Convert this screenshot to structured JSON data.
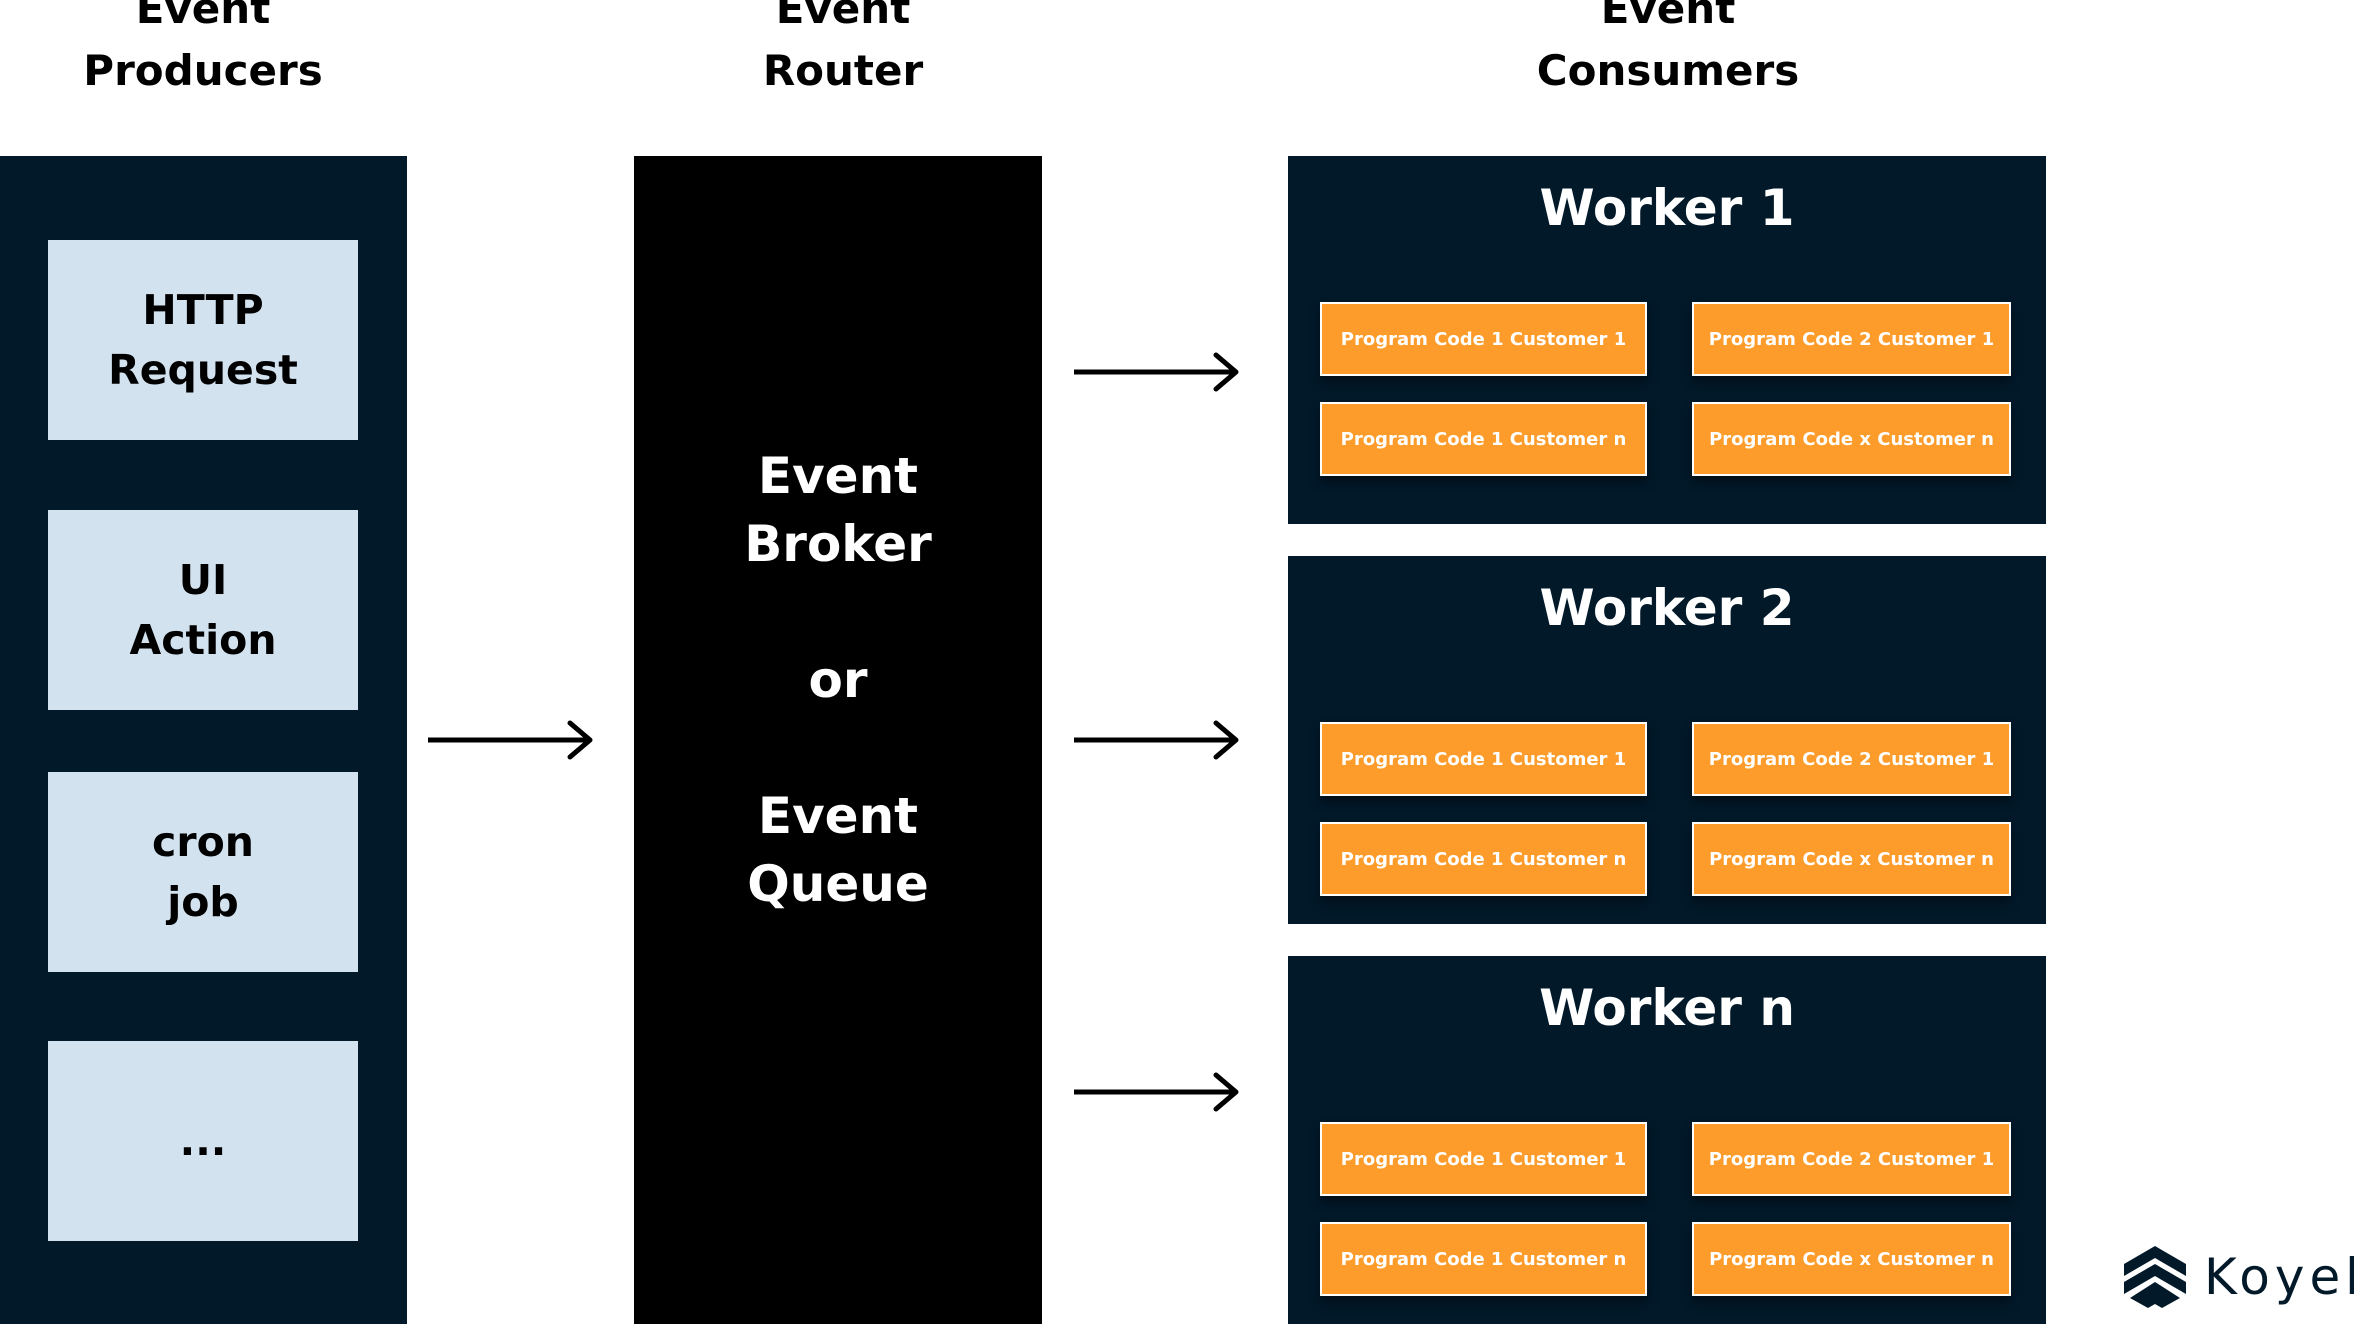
{
  "headers": {
    "producers": [
      "Event",
      "Producers"
    ],
    "router": [
      "Event",
      "Router"
    ],
    "consumers": [
      "Event",
      "Consumers"
    ]
  },
  "producers": [
    {
      "lines": [
        "HTTP",
        "Request"
      ]
    },
    {
      "lines": [
        "UI",
        "Action"
      ]
    },
    {
      "lines": [
        "cron",
        "job"
      ]
    },
    {
      "lines": [
        "..."
      ]
    }
  ],
  "router": {
    "lines": [
      "Event",
      "Broker",
      "or",
      "Event",
      "Queue"
    ]
  },
  "workers": [
    {
      "title": "Worker 1",
      "programs": [
        "Program Code 1 Customer 1",
        "Program Code 2 Customer 1",
        "Program Code 1 Customer n",
        "Program Code x Customer n"
      ]
    },
    {
      "title": "Worker 2",
      "programs": [
        "Program Code 1 Customer 1",
        "Program Code 2 Customer 1",
        "Program Code 1 Customer n",
        "Program Code x Customer n"
      ]
    },
    {
      "title": "Worker n",
      "programs": [
        "Program Code 1 Customer 1",
        "Program Code 2 Customer 1",
        "Program Code 1 Customer n",
        "Program Code x Customer n"
      ]
    }
  ],
  "icons": {
    "arrow": "arrow-right-icon",
    "logo": "koyeb-logo-icon"
  },
  "brand": {
    "name": "Koyeb"
  },
  "colors": {
    "panel": "#02192a",
    "producer_box": "#d2e2ef",
    "router": "#000000",
    "program_box": "#fd9c2a"
  }
}
